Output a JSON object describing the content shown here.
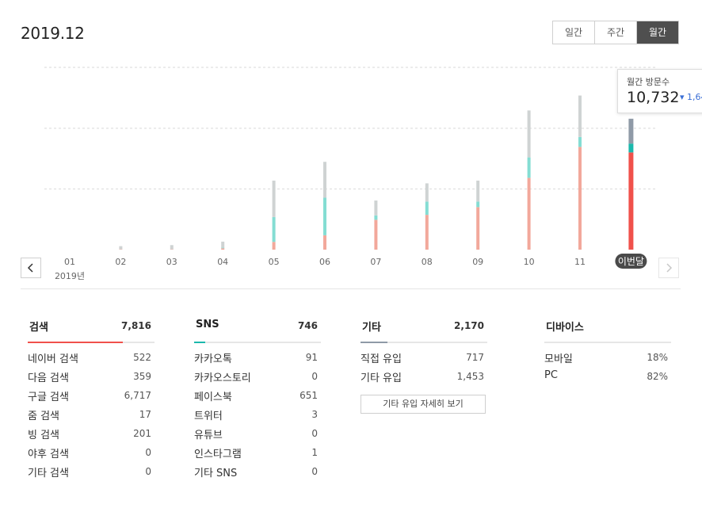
{
  "page_title": "2019.12",
  "period_tabs": [
    {
      "label": "일간",
      "active": false
    },
    {
      "label": "주간",
      "active": false
    },
    {
      "label": "월간",
      "active": true
    }
  ],
  "tooltip": {
    "label": "월간 방문수",
    "value": "10,732",
    "delta": "1,64"
  },
  "colors": {
    "search": "#f2a89b",
    "search_current": "#f0514b",
    "sns": "#84ddd3",
    "sns_current": "#1bb8ac",
    "other": "#cfd3d3",
    "other_current": "#8f9aa7"
  },
  "chart_data": {
    "type": "bar",
    "stacked": true,
    "categories": [
      "01",
      "02",
      "03",
      "04",
      "05",
      "06",
      "07",
      "08",
      "09",
      "10",
      "11",
      "이번달"
    ],
    "year_label": "2019년",
    "current_index": 11,
    "series": [
      {
        "key": "search",
        "values": [
          0,
          60,
          60,
          250,
          1400,
          2600,
          5400,
          6300,
          7700,
          13000,
          18600,
          17600
        ]
      },
      {
        "key": "sns",
        "values": [
          0,
          0,
          0,
          100,
          4500,
          6800,
          800,
          2400,
          1000,
          3700,
          1800,
          1600
        ]
      },
      {
        "key": "other",
        "values": [
          0,
          570,
          760,
          1100,
          6600,
          6500,
          2700,
          3300,
          3800,
          8500,
          7500,
          4500
        ]
      }
    ],
    "ylim": [
      0,
      33000
    ],
    "grid": true
  },
  "panels": [
    {
      "name": "검색",
      "total": "7,816",
      "accent": "#f0514b",
      "accent_width": 120,
      "rows": [
        {
          "label": "네이버 검색",
          "value": "522"
        },
        {
          "label": "다음 검색",
          "value": "359"
        },
        {
          "label": "구글 검색",
          "value": "6,717"
        },
        {
          "label": "줌 검색",
          "value": "17"
        },
        {
          "label": "빙 검색",
          "value": "201"
        },
        {
          "label": "야후 검색",
          "value": "0"
        },
        {
          "label": "기타 검색",
          "value": "0"
        }
      ]
    },
    {
      "name": "SNS",
      "total": "746",
      "accent": "#1bb8ac",
      "accent_width": 14,
      "rows": [
        {
          "label": "카카오톡",
          "value": "91"
        },
        {
          "label": "카카오스토리",
          "value": "0"
        },
        {
          "label": "페이스북",
          "value": "651"
        },
        {
          "label": "트위터",
          "value": "3"
        },
        {
          "label": "유튜브",
          "value": "0"
        },
        {
          "label": "인스타그램",
          "value": "1"
        },
        {
          "label": "기타 SNS",
          "value": "0"
        }
      ]
    },
    {
      "name": "기타",
      "total": "2,170",
      "accent": "#8f9aa7",
      "accent_width": 34,
      "rows": [
        {
          "label": "직접 유입",
          "value": "717"
        },
        {
          "label": "기타 유입",
          "value": "1,453"
        }
      ],
      "button": "기타 유입 자세히 보기"
    },
    {
      "name": "디바이스",
      "total": "",
      "accent": "",
      "accent_width": 0,
      "rows": [
        {
          "label": "모바일",
          "value": "18%"
        },
        {
          "label": "PC",
          "value": "82%"
        }
      ]
    }
  ]
}
